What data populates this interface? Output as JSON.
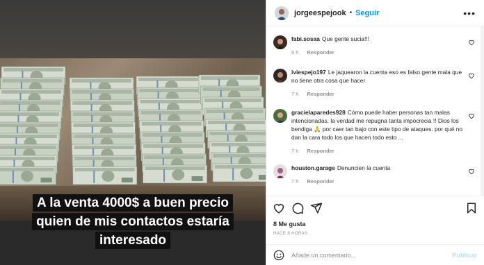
{
  "post": {
    "author": "jorgeespejook",
    "follow_label": "Seguir",
    "caption_lines": [
      "A la venta 4000$ a buen precio",
      "quien de mis contactos estaría",
      "interesado"
    ],
    "likes": "8 Me gusta",
    "date": "HACE 8 HORAS"
  },
  "comments": [
    {
      "user": "fabi.sosaa",
      "text": "Que gente sucia!!!",
      "time": "6 h",
      "reply": "Responder"
    },
    {
      "user": "iviespejo197",
      "text": "Le jaquearon la cuenta eso es falso gente mala que no tiene otra cosa que hacer",
      "time": "7 h",
      "reply": "Responder"
    },
    {
      "user": "gracielaparedes928",
      "text": "Cómo puede haber personas tan malas intencionadas. la verdad me repugna tanta impocrecia !! Dios los bendiga 🙏 por caer tan bajo con este tipo de ataques. por qué no dan la cara todo los que hacen todo esto ...",
      "time": "7 h",
      "reply": "Responder"
    },
    {
      "user": "houston.garage",
      "text": "Denuncien la cuenta",
      "time": "7 h",
      "reply": "Responder"
    }
  ],
  "composer": {
    "placeholder": "Añade un comentario...",
    "publish_label": "Publicar"
  },
  "colors": {
    "accent": "#0095f6",
    "publish_disabled": "#b2dffc",
    "caption_bg": "#111111"
  }
}
